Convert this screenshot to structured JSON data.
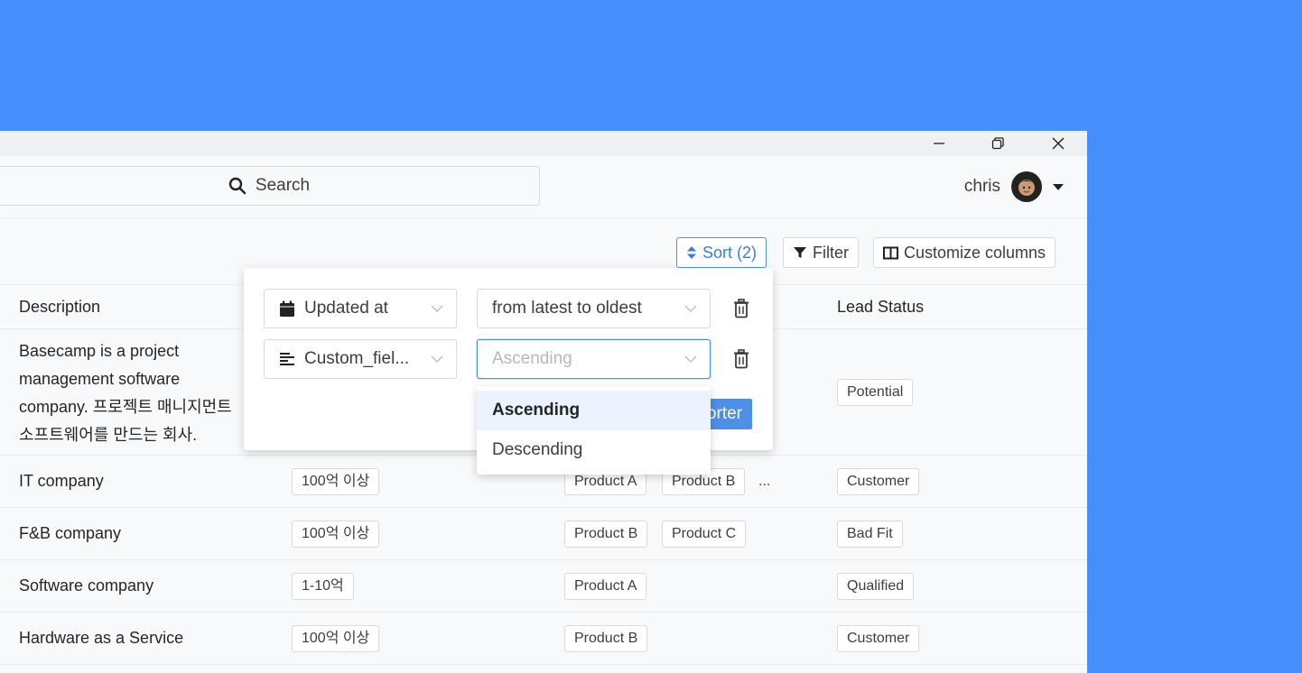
{
  "window": {
    "minimize_icon": "minimize-icon",
    "restore_icon": "restore-icon",
    "close_icon": "close-icon"
  },
  "header": {
    "search_placeholder": "Search",
    "username": "chris"
  },
  "toolbar": {
    "sort_label": "Sort (2)",
    "filter_label": "Filter",
    "customize_label": "Customize columns"
  },
  "table": {
    "columns": {
      "description": "Description",
      "lead_status": "Lead Status"
    },
    "rows": [
      {
        "description_lines": [
          "Basecamp is a project",
          "management software",
          "company. 프로젝트 매니지먼트",
          "소프트웨어를 만드는 회사."
        ],
        "revenue": "",
        "products": [],
        "status": "Potential"
      },
      {
        "description": "IT company",
        "revenue": "100억 이상",
        "products": [
          "Product A",
          "Product B"
        ],
        "more": "...",
        "status": "Customer"
      },
      {
        "description": "F&B company",
        "revenue": "100억 이상",
        "products": [
          "Product B",
          "Product C"
        ],
        "status": "Bad Fit"
      },
      {
        "description": "Software company",
        "revenue": "1-10억",
        "products": [
          "Product A"
        ],
        "status": "Qualified"
      },
      {
        "description": "Hardware as a Service",
        "revenue": "100억 이상",
        "products": [
          "Product B"
        ],
        "status": "Customer"
      }
    ]
  },
  "sort_panel": {
    "rules": [
      {
        "field": "Updated at",
        "field_icon": "calendar-icon",
        "order": "from latest to oldest"
      },
      {
        "field": "Custom_fiel...",
        "field_icon": "text-align-icon",
        "order_placeholder": "Ascending"
      }
    ],
    "add_button_visible": "orter",
    "dropdown_options": [
      "Ascending",
      "Descending"
    ],
    "dropdown_selected": "Ascending"
  },
  "colors": {
    "background": "#448ffb",
    "accent": "#4e8fe8",
    "selected_option_bg": "#eaf3ff"
  }
}
